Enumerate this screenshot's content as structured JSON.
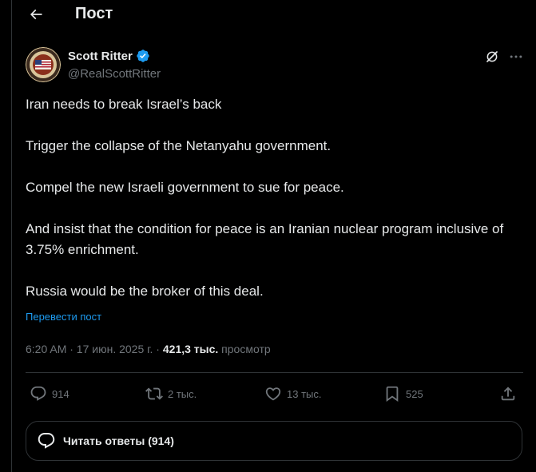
{
  "header": {
    "title": "Пост"
  },
  "author": {
    "name": "Scott Ritter",
    "handle": "@RealScottRitter",
    "verified_color": "#1d9bf0"
  },
  "tweet": {
    "paragraphs": [
      "Iran needs to break Israel’s back",
      "Trigger the collapse of the Netanyahu government.",
      "Compel the new Israeli government to sue for peace.",
      "And insist that the condition for peace is an Iranian nuclear program inclusive of 3.75% enrichment.",
      "Russia would be the broker of this deal."
    ],
    "translate_label": "Перевести пост",
    "timestamp": "6:20 AM · 17 июн. 2025 г.",
    "separator": " · ",
    "views_count": "421,3 тыс.",
    "views_label": " просмотр"
  },
  "actions": {
    "replies": "914",
    "reposts": "2 тыс.",
    "likes": "13 тыс.",
    "bookmarks": "525"
  },
  "replies_button": {
    "label": "Читать ответы (914)"
  },
  "icons": {
    "back": "arrow-left-icon",
    "grok": "grok-icon",
    "more": "more-dots-icon",
    "reply": "reply-bubble-icon",
    "repost": "repost-icon",
    "like": "heart-icon",
    "bookmark": "bookmark-icon",
    "share": "share-icon"
  },
  "colors": {
    "background": "#000000",
    "text": "#e7e9ea",
    "secondary": "#71767b",
    "accent": "#1d9bf0",
    "border": "#2f3336"
  }
}
